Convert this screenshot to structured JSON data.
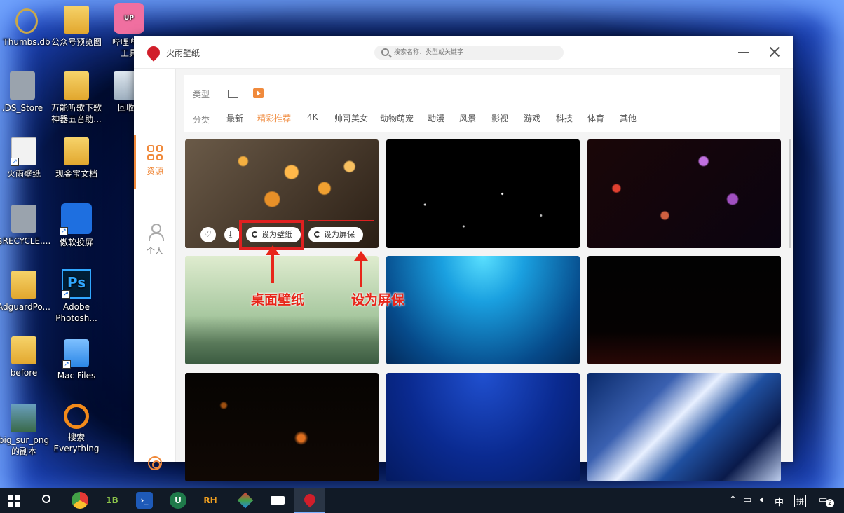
{
  "desktop": {
    "icons": [
      {
        "label": "Thumbs.db"
      },
      {
        "label": "公众号预览图"
      },
      {
        "label": "哔哩哔哩",
        "label2": "工具",
        "badge": "UP"
      },
      {
        "label": ".DS_Store"
      },
      {
        "label": "万能听歌下歌",
        "label2": "神器五音助..."
      },
      {
        "label": "回收"
      },
      {
        "label": "火雨壁纸"
      },
      {
        "label": "现金宝文档"
      },
      {
        "label": "$RECYCLE...."
      },
      {
        "label": "傲软投屏"
      },
      {
        "label": "AdguardPo..."
      },
      {
        "label": "Adobe",
        "label2": "Photosh...",
        "glyph": "Ps"
      },
      {
        "label": "before"
      },
      {
        "label": "Mac Files"
      },
      {
        "label": "big_sur_png",
        "label2": "的副本"
      },
      {
        "label": "搜索",
        "label2": "Everything"
      }
    ]
  },
  "window": {
    "title": "火雨壁纸",
    "search_placeholder": "搜索名称、类型或关键字"
  },
  "sidebar": {
    "items": [
      {
        "label": "资源",
        "active": true
      },
      {
        "label": "个人",
        "active": false
      }
    ]
  },
  "filter": {
    "type_label": "类型",
    "category_label": "分类",
    "categories": [
      "最新",
      "精彩推荐",
      "4K",
      "帅哥美女",
      "动物萌宠",
      "动漫",
      "风景",
      "影视",
      "游戏",
      "科技",
      "体育",
      "其他"
    ],
    "active_category": "精彩推荐"
  },
  "card_actions": {
    "set_wallpaper": "设为壁纸",
    "set_screensaver": "设为屏保"
  },
  "annotations": {
    "desktop_wallpaper": "桌面壁纸",
    "screensaver": "设为屏保"
  },
  "taskbar": {
    "apps": [
      "1B",
      "RH"
    ],
    "ime": "中",
    "pinyin": "拼",
    "notification_count": "2"
  },
  "colors": {
    "accent": "#f08a3c",
    "annotation_red": "#e8261a"
  }
}
